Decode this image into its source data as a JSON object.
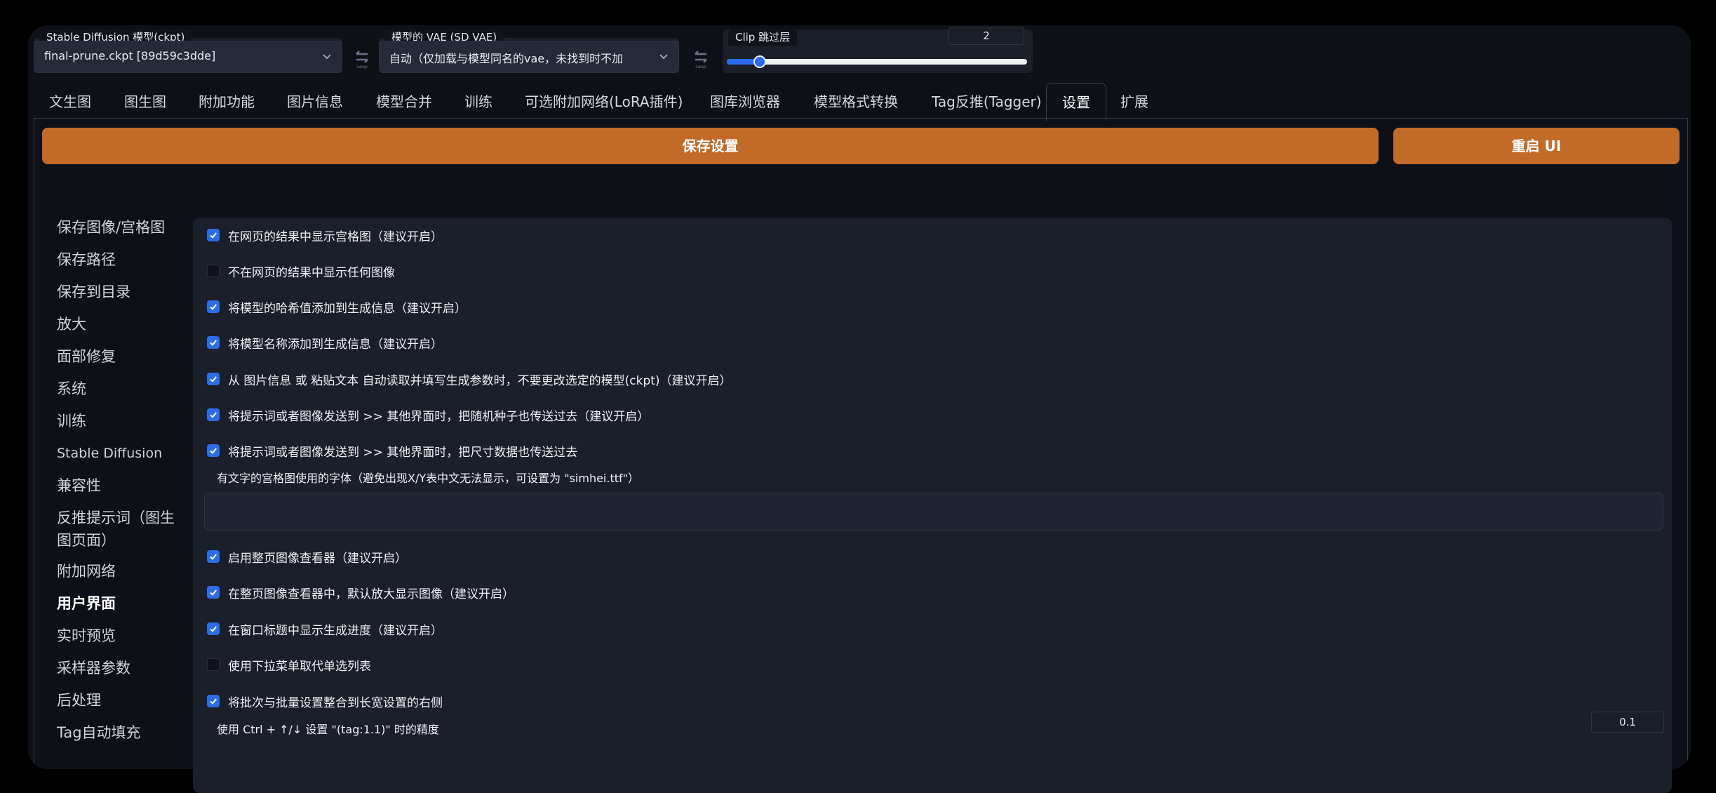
{
  "top": {
    "model_label": "Stable Diffusion 模型(ckpt)",
    "model_value": "final-prune.ckpt [89d59c3dde]",
    "vae_label": "模型的 VAE (SD VAE)",
    "vae_value": "自动（仅加载与模型同名的vae，未找到时不加",
    "clip_label": "Clip 跳过层",
    "clip_value": "2",
    "clip_fraction": 0.11,
    "refresh_icon": "swap-arrows-icon",
    "dropdown_icon": "chevron-down-icon"
  },
  "tabs": [
    {
      "label": "文生图"
    },
    {
      "label": "图生图"
    },
    {
      "label": "附加功能"
    },
    {
      "label": "图片信息"
    },
    {
      "label": "模型合并"
    },
    {
      "label": "训练"
    },
    {
      "label": "可选附加网络(LoRA插件)"
    },
    {
      "label": "图库浏览器"
    },
    {
      "label": "模型格式转换"
    },
    {
      "label": "Tag反推(Tagger)"
    },
    {
      "label": "设置",
      "active": true
    },
    {
      "label": "扩展"
    }
  ],
  "actions": {
    "save_label": "保存设置",
    "restart_label": "重启 UI",
    "accent_color": "#c26a27"
  },
  "sidebar": {
    "items": [
      {
        "label": "保存图像/宫格图"
      },
      {
        "label": "保存路径"
      },
      {
        "label": "保存到目录"
      },
      {
        "label": "放大"
      },
      {
        "label": "面部修复"
      },
      {
        "label": "系统"
      },
      {
        "label": "训练"
      },
      {
        "label": "Stable Diffusion"
      },
      {
        "label": "兼容性"
      },
      {
        "label": "反推提示词（图生"
      },
      {
        "label": "图页面）"
      },
      {
        "label": "附加网络"
      },
      {
        "label": "用户界面",
        "active": true
      },
      {
        "label": "实时预览"
      },
      {
        "label": "采样器参数"
      },
      {
        "label": "后处理"
      },
      {
        "label": "Tag自动填充"
      }
    ]
  },
  "settings": {
    "options": [
      {
        "label": "在网页的结果中显示宫格图（建议开启）",
        "checked": true
      },
      {
        "label": "不在网页的结果中显示任何图像",
        "checked": false
      },
      {
        "label": "将模型的哈希值添加到生成信息（建议开启）",
        "checked": true
      },
      {
        "label": "将模型名称添加到生成信息（建议开启）",
        "checked": true
      },
      {
        "label": "从 图片信息 或 粘贴文本 自动读取并填写生成参数时，不要更改选定的模型(ckpt)（建议开启）",
        "checked": true
      },
      {
        "label": "将提示词或者图像发送到 >> 其他界面时，把随机种子也传送过去（建议开启）",
        "checked": true
      },
      {
        "label": "将提示词或者图像发送到 >> 其他界面时，把尺寸数据也传送过去",
        "checked": true
      }
    ],
    "font_field_label": "有文字的宫格图使用的字体（避免出现X/Y表中文无法显示，可设置为 \"simhei.ttf\"）",
    "font_field_value": "",
    "options2": [
      {
        "label": "启用整页图像查看器（建议开启）",
        "checked": true
      },
      {
        "label": "在整页图像查看器中，默认放大显示图像（建议开启）",
        "checked": true
      },
      {
        "label": "在窗口标题中显示生成进度（建议开启）",
        "checked": true
      },
      {
        "label": "使用下拉菜单取代单选列表",
        "checked": false
      },
      {
        "label": "将批次与批量设置整合到长宽设置的右侧",
        "checked": true
      }
    ],
    "precision_label": "使用 Ctrl + ↑/↓ 设置 \"(tag:1.1)\" 时的精度",
    "precision_value": "0.1"
  }
}
